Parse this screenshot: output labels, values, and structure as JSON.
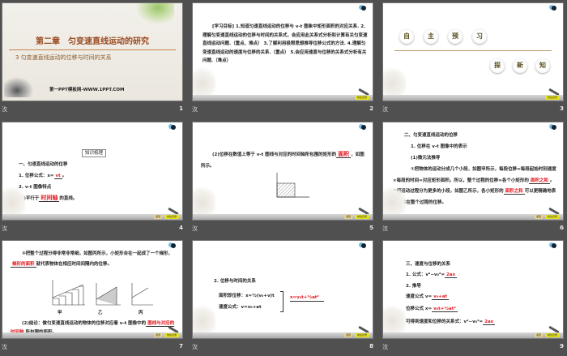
{
  "caption_left": "㳊",
  "nav": {
    "back": "返回",
    "index": "前往目录"
  },
  "slides": [
    {
      "number": "1",
      "title": "第二章　匀变速直线运动的研究",
      "subtitle": "3  匀变速直线运动的位移与时间的关系",
      "site": "第一PPT模板网-WWW.1PPT.COM"
    },
    {
      "number": "2",
      "text": "[学习目标]  1.知道匀速直线运动的位移与 v-t 图象中矩形面积的对应关系. 2.理解匀变速直线运动的位移与时间的关系式，会应用此关系式分析和计算有关匀变速直线运动问题.（重点、难点） 3.了解利用极限思想推导位移公式的方法. 4.理解匀变速直线运动的速度与位移的关系.（重点） 5.会应用速度与位移的关系式分析有关问题.（难点）"
    },
    {
      "number": "3",
      "top": [
        "自",
        "主",
        "预",
        "习"
      ],
      "bottom": [
        "探",
        "新",
        "知"
      ]
    },
    {
      "number": "4",
      "heading": "知识梳理",
      "l1": "一、匀速直线运动的位移",
      "l2": "1. 位移公式：x=",
      "a2": "vt",
      "l2e": "。",
      "l3": "2. v-t 图像特点",
      "l4": "(1)平行于",
      "a4": "时间轴",
      "l4e": "的直线。"
    },
    {
      "number": "5",
      "l1": "(2)位移在数值上等于 v-t 图线与对应的时间轴所包围的矩形的",
      "a1": "面积",
      "l1e": "，如图所示。"
    },
    {
      "number": "6",
      "l1": "二、匀变速直线运动的位移",
      "l2": "1. 位移在 v-t 图像中的表示",
      "l3": "(1)微元法推导",
      "l4": "①把物体的运动分成几个小段，如图甲所示，每段位移≈每段起始时刻速度×每段的时间=对应矩形面积。所以，整个过程的位移≈各个小矩形的",
      "a4": "面积之和",
      "l4e": "。",
      "l5": "②把运动过程分为更多的小段，如图乙所示，各小矩形的",
      "a5": "面积之和",
      "l5e": "可以更精确地表示物体在整个过程的位移。"
    },
    {
      "number": "7",
      "l1": "③把整个过程分得非常非常细，如图丙所示，小矩形合在一起成了一个梯形，",
      "a1": "梯形的面积",
      "l1e": "就代表物体在相应时间间隔内的位移。",
      "labels": [
        "甲",
        "乙",
        "丙"
      ],
      "l2": "(2)结论：做匀变速直线运动的物体的位移对应着 v-t 图像中的",
      "a2": "图线与对应的时间轴",
      "l2e": "所包围的面积。"
    },
    {
      "number": "8",
      "l1": "2. 位移与时间的关系",
      "l2": "面积即位移：x=½(v₀+v)t",
      "l3": "速度公式：v=v₀+at",
      "a": "x=v₀t+½at²"
    },
    {
      "number": "9",
      "l1": "三、速度与位移的关系",
      "l2": "1. 公式：v²−v₀²=",
      "a2": "2ax",
      "l3": "2. 推导",
      "l4": "速度公式 v=",
      "a4": "v₀+at",
      "l5": "位移公式 x=",
      "a5": "v₀t+½at²",
      "l6": "可得到速度和位移的关系式：v²−v₀²=",
      "a6": "2ax"
    }
  ]
}
